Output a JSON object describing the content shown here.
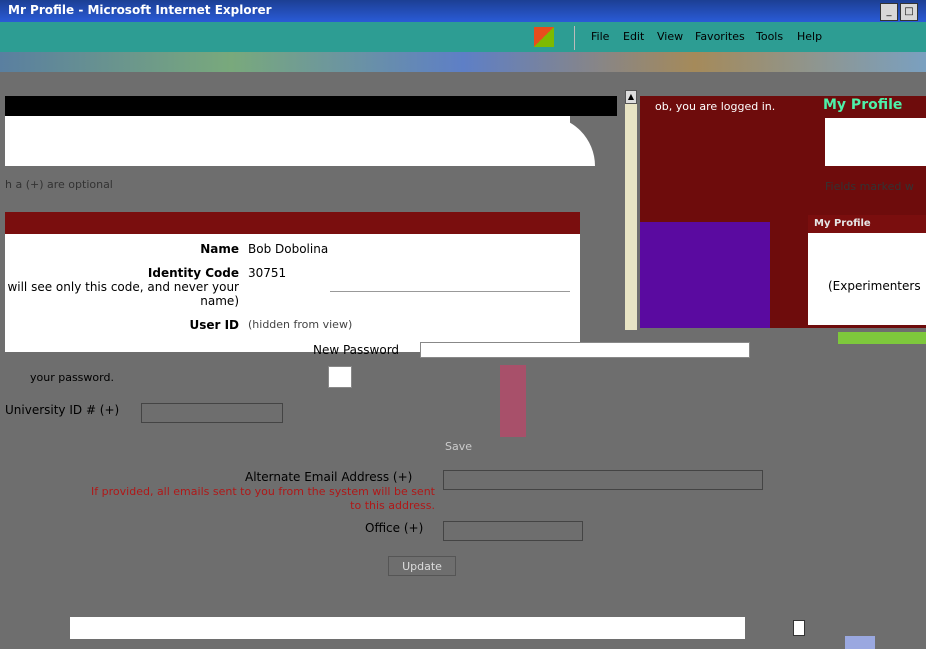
{
  "window": {
    "title": "Mr Profile - Microsoft Internet Explorer",
    "minimize": "_",
    "maximize": "□"
  },
  "menu": {
    "items": [
      {
        "label": "File"
      },
      {
        "label": "Edit"
      },
      {
        "label": "View"
      },
      {
        "label": "Favorites"
      },
      {
        "label": "Tools"
      },
      {
        "label": "Help"
      }
    ]
  },
  "header": {
    "logged_in": "ob, you are logged in.",
    "profile_title": "My Profile"
  },
  "notes": {
    "optional": "h a (+) are optional",
    "fields_marked": "Fields marked w"
  },
  "profile": {
    "name_label": "Name",
    "name_value": "Bob Dobolina",
    "identity_label": "Identity Code",
    "identity_value": "30751",
    "identity_note": "will see only this code, and never your name)",
    "userid_label": "User ID",
    "userid_value": "(hidden from view)"
  },
  "sidebar_box": {
    "caption": "My Profile",
    "text": "(Experimenters"
  },
  "form": {
    "new_password_label": "New Password",
    "password_note": "your password.",
    "university_label": "University ID # (+)",
    "save_label": "Save",
    "alt_email_label": "Alternate Email Address (+)",
    "alt_email_note": "If provided, all emails sent to you from the system will be sent to this address.",
    "office_label": "Office (+)",
    "update_button": "Update"
  }
}
